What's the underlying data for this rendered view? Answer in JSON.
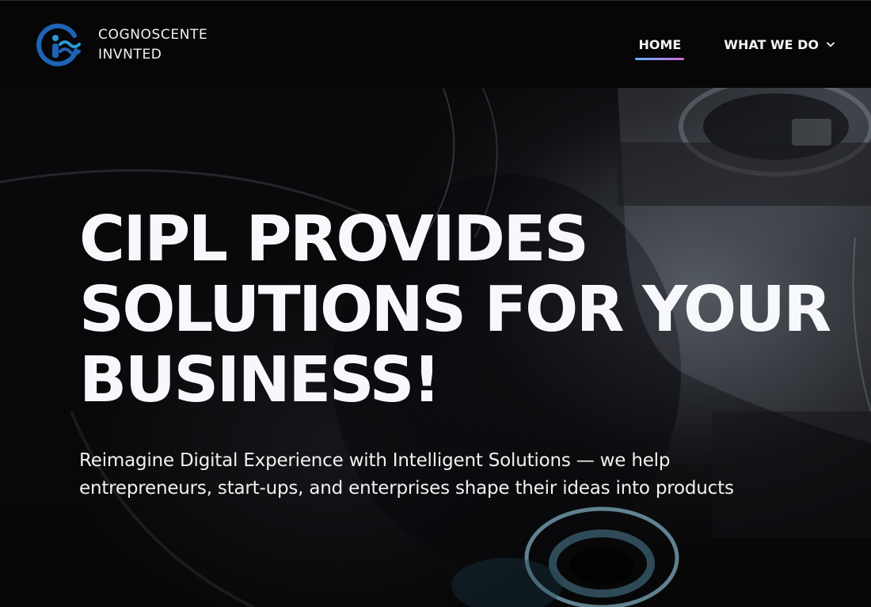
{
  "brand": {
    "name_line1": "COGNOSCENTE",
    "name_line2": "INVNTED",
    "logo_icon": "brand-logo-icon",
    "logo_color": "#1e63b5"
  },
  "nav": {
    "items": [
      {
        "label": "HOME",
        "active": true
      },
      {
        "label": "WHAT WE DO",
        "has_dropdown": true,
        "icon": "chevron-down-icon"
      }
    ],
    "active_underline_colors": [
      "#5fb6ff",
      "#d26bd9"
    ]
  },
  "hero": {
    "heading_lines": [
      "CIPL PROVIDES",
      "SOLUTIONS FOR YOUR",
      "BUSINESS!"
    ],
    "subheading": "Reimagine Digital Experience with Intelligent Solutions — we help entrepreneurs, start-ups, and enterprises shape their ideas into products"
  }
}
